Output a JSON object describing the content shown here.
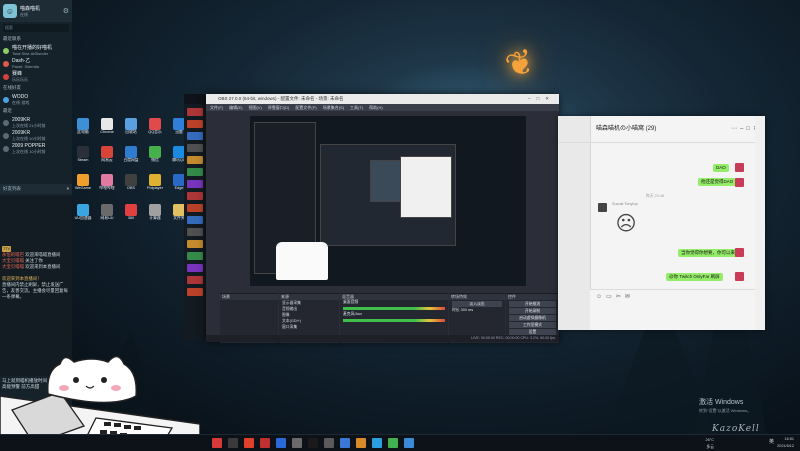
{
  "live_panel": {
    "title": "喵森喵机",
    "subtitle": "在线",
    "search_placeholder": "搜索",
    "section_recent": "最近联系",
    "recent": [
      {
        "name": "喵在开播的好喵机",
        "meta": "Total Stat: Ai/Bonder"
      },
      {
        "name": "Dash·乙",
        "meta": "Panel: Sidentia"
      },
      {
        "name": "赛峰",
        "meta": "乐乐乐乐"
      }
    ],
    "section_online": "在线好友",
    "online": [
      {
        "name": "WODO",
        "meta": "在线·游戏"
      }
    ],
    "section_other": "最近",
    "others": [
      {
        "name": "2009KR",
        "meta": "上次在线 21小时前"
      },
      {
        "name": "2009KR",
        "meta": "上次在线 10小时前"
      },
      {
        "name": "2009 POPPER",
        "meta": "上次在线 10小时前"
      }
    ],
    "filter_label": "好友列表",
    "chat_lines": [
      {
        "badge": "TTV",
        "who": "",
        "text": ""
      },
      {
        "badge": "",
        "who": "永恒的喵巴",
        "text": "欢迎来喵喵直播间"
      },
      {
        "badge": "",
        "who": "大宝贝喵喵",
        "text": "关注了你"
      },
      {
        "badge": "",
        "who": "大宝贝喵喵",
        "text": "欢迎来到本直播间"
      }
    ],
    "notice": "欢迎来到本直播间！",
    "notice_body": "直播间内禁止刷屏，禁止发送广告，友善交流。主播会尽量回复每一条弹幕。",
    "footer_lines": [
      "马上就到喵机播放时间",
      "高能预警 前方高甜"
    ]
  },
  "desktop_icons": [
    "此电脑",
    "Chrome",
    "回收站",
    "QQ音乐",
    "迅雷",
    "Steam",
    "网易云",
    "百度网盘",
    "微信",
    "腾讯QQ",
    "WeGame",
    "哔哩哔哩",
    "OBS",
    "Potplayer",
    "Edge",
    "UU加速器",
    "网易UU",
    "360",
    "计算器",
    "文件夹",
    "设置",
    "TIM",
    "Photoshop",
    "Premiere"
  ],
  "obs": {
    "title": "OBS 27.0.0 (64-bit, windows) - 配置文件: 未命名 - 场景: 未命名",
    "menu": [
      "文件(F)",
      "编辑(E)",
      "视图(V)",
      "停靠窗口(D)",
      "配置文件(P)",
      "场景集合(S)",
      "工具(T)",
      "帮助(H)"
    ],
    "docks": {
      "scenes": "场景",
      "sources": "来源",
      "mixer": "混音器",
      "transitions": "转场特效",
      "controls": "控件"
    },
    "sources_list": [
      "显示器采集",
      "音频输出",
      "图像",
      "文本(GDI+)",
      "窗口采集"
    ],
    "mixer_channels": [
      "桌面音频",
      "麦克风/Aux"
    ],
    "transition_value": "淡入淡出",
    "duration_label": "时长",
    "duration_value": "300 ms",
    "controls": [
      "开始推流",
      "开始录制",
      "启动虚拟摄像机",
      "工作室模式",
      "设置",
      "退出"
    ],
    "status": "LIVE: 00:00:00  REC: 00:00:00  CPU: 3.2%, 60.00 fps"
  },
  "chat": {
    "title": "喵森喵机の小喵窝 (29)",
    "messages": [
      {
        "side": "right",
        "text": "DAO"
      },
      {
        "side": "right",
        "text": "他还是觉得DAO"
      },
      {
        "side": "left",
        "sender": "Suzuki Tonytop",
        "text": "(sticker)"
      },
      {
        "side": "right",
        "text": "当你觉得你想要，你可以来"
      },
      {
        "side": "right",
        "text": "@你 Twitch OnlyFar 刷屏"
      }
    ],
    "timestamp": "昨天 22:46"
  },
  "activation": {
    "title": "激活 Windows",
    "subtitle": "转到“设置”以激活 Windows。"
  },
  "signature": "KazoKell",
  "taskbar": {
    "weather": "26°C",
    "weather_sub": "多云",
    "time": "16:51",
    "date": "2021/6/12",
    "ime": "英"
  },
  "colors": {
    "accent": "#f6a23a",
    "chat_bubble": "#95ec69",
    "obs_bg": "#2b2e38"
  }
}
